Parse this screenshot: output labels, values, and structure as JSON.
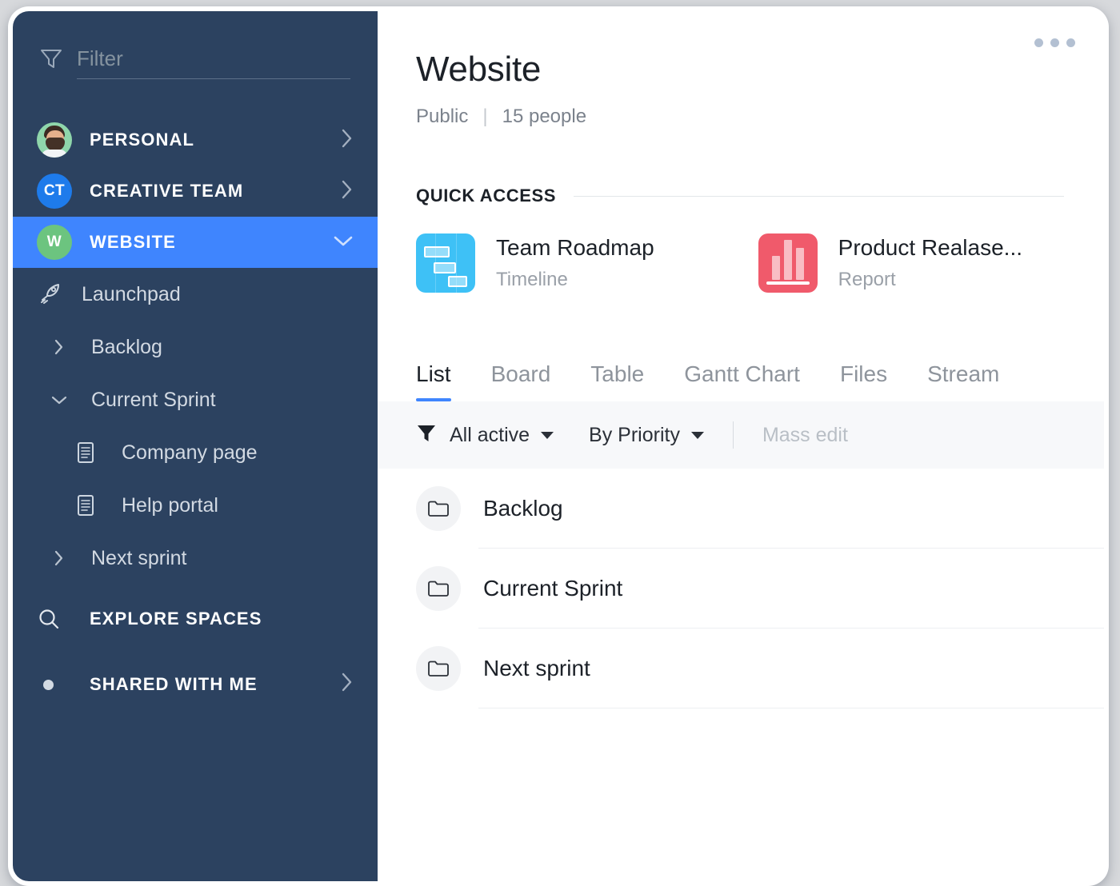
{
  "sidebar": {
    "filter": {
      "placeholder": "Filter",
      "value": "",
      "icon": "funnel-icon"
    },
    "spaces": [
      {
        "label": "PERSONAL",
        "badge": "",
        "avatar_type": "photo",
        "chevron": "chevron-right-icon",
        "active": false
      },
      {
        "label": "CREATIVE TEAM",
        "badge": "CT",
        "avatar_type": "initials",
        "chevron": "chevron-right-icon",
        "active": false
      },
      {
        "label": "WEBSITE",
        "badge": "W",
        "avatar_type": "initials",
        "chevron": "chevron-down-icon",
        "active": true
      }
    ],
    "tree": [
      {
        "label": "Launchpad",
        "icon": "rocket-icon",
        "level": 1,
        "twisty": "none"
      },
      {
        "label": "Backlog",
        "icon": "none",
        "level": 1,
        "twisty": "chevron-right-icon"
      },
      {
        "label": "Current Sprint",
        "icon": "none",
        "level": 1,
        "twisty": "chevron-down-icon"
      },
      {
        "label": "Company page",
        "icon": "document-icon",
        "level": 2,
        "twisty": "none"
      },
      {
        "label": "Help portal",
        "icon": "document-icon",
        "level": 2,
        "twisty": "none"
      },
      {
        "label": "Next sprint",
        "icon": "none",
        "level": 1,
        "twisty": "chevron-right-icon"
      }
    ],
    "nav": [
      {
        "label": "EXPLORE SPACES",
        "icon": "search-icon",
        "chevron": ""
      },
      {
        "label": "SHARED WITH ME",
        "icon": "dot-icon",
        "chevron": "chevron-right-icon"
      }
    ],
    "colors": {
      "background": "#2c4260",
      "active": "#3f85fe",
      "text": "#d3dae3"
    }
  },
  "header": {
    "title": "Website",
    "visibility": "Public",
    "separator": "|",
    "people": "15 people",
    "more_icon": "ellipsis-icon"
  },
  "quick_access": {
    "title": "QUICK ACCESS",
    "items": [
      {
        "name": "Team Roadmap",
        "type": "Timeline",
        "icon": "timeline-icon",
        "color": "#3ec1f6"
      },
      {
        "name": "Product Realase...",
        "type": "Report",
        "icon": "bar-chart-icon",
        "color": "#f05a6b"
      }
    ]
  },
  "tabs": [
    {
      "label": "List",
      "active": true
    },
    {
      "label": "Board",
      "active": false
    },
    {
      "label": "Table",
      "active": false
    },
    {
      "label": "Gantt Chart",
      "active": false
    },
    {
      "label": "Files",
      "active": false
    },
    {
      "label": "Stream",
      "active": false
    }
  ],
  "toolbar": {
    "filter_icon": "funnel-filled-icon",
    "filter_label": "All active",
    "sort_label": "By Priority",
    "mass_edit_label": "Mass edit"
  },
  "list": {
    "rows": [
      {
        "label": "Backlog",
        "icon": "folder-icon"
      },
      {
        "label": "Current Sprint",
        "icon": "folder-icon"
      },
      {
        "label": "Next sprint",
        "icon": "folder-icon"
      }
    ]
  }
}
